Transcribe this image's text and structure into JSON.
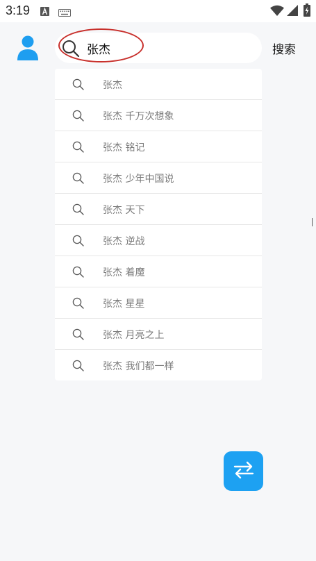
{
  "status_bar": {
    "time": "3:19",
    "icons": [
      "app-a-icon",
      "keyboard-icon",
      "wifi-icon",
      "signal-icon",
      "battery-icon"
    ]
  },
  "header": {
    "avatar": "user-avatar-icon",
    "search": {
      "value": "张杰",
      "icon": "search-icon"
    },
    "search_button_label": "搜索"
  },
  "suggestions": [
    {
      "label": "张杰",
      "icon": "search-icon"
    },
    {
      "label": "张杰 千万次想象",
      "icon": "search-icon"
    },
    {
      "label": "张杰 铭记",
      "icon": "search-icon"
    },
    {
      "label": "张杰 少年中国说",
      "icon": "search-icon"
    },
    {
      "label": "张杰 天下",
      "icon": "search-icon"
    },
    {
      "label": "张杰 逆战",
      "icon": "search-icon"
    },
    {
      "label": "张杰 着魔",
      "icon": "search-icon"
    },
    {
      "label": "张杰 星星",
      "icon": "search-icon"
    },
    {
      "label": "张杰 月亮之上",
      "icon": "search-icon"
    },
    {
      "label": "张杰 我们都一样",
      "icon": "search-icon"
    }
  ],
  "fab": {
    "icon": "swap-arrows-icon"
  },
  "colors": {
    "accent": "#1da1f2",
    "avatar": "#1e9ef0",
    "highlight": "#c8302c",
    "background": "#f6f7f9"
  }
}
